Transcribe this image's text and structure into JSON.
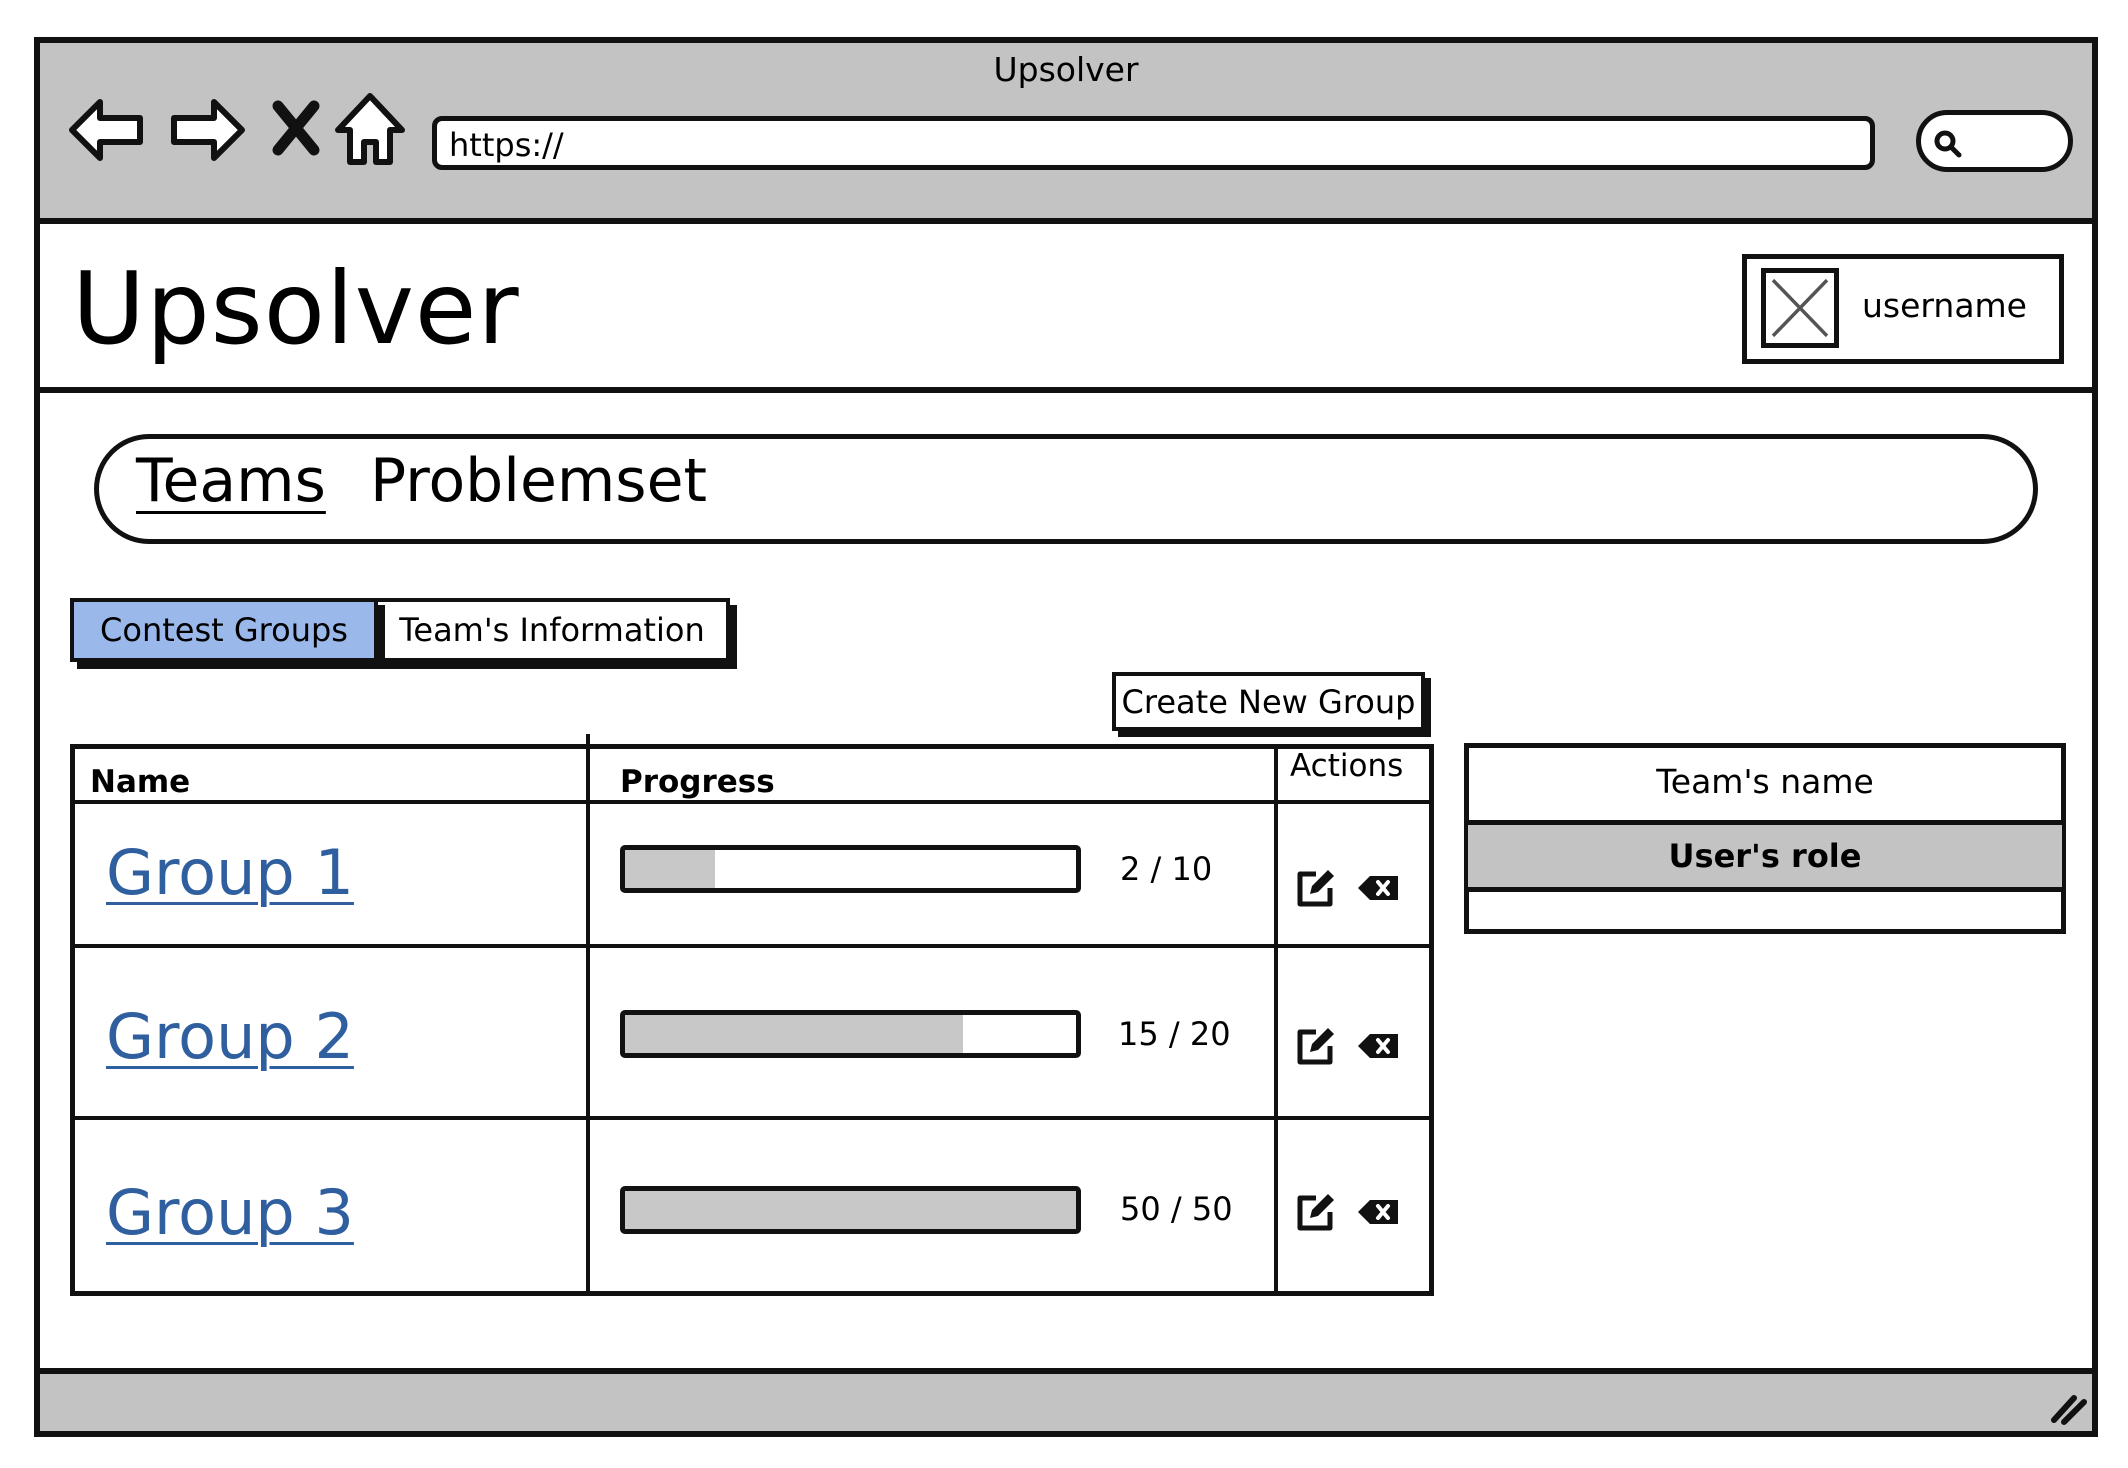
{
  "browser": {
    "title": "Upsolver",
    "url": "https://",
    "icons": [
      "back-arrow-icon",
      "forward-arrow-icon",
      "close-icon",
      "home-icon",
      "search-icon",
      "resize-grip-icon"
    ]
  },
  "app": {
    "title": "Upsolver",
    "username": "username"
  },
  "nav": {
    "items": [
      {
        "label": "Teams",
        "active": true
      },
      {
        "label": "Problemset",
        "active": false
      }
    ]
  },
  "tabs": [
    {
      "label": "Contest Groups",
      "selected": true
    },
    {
      "label": "Team's Information",
      "selected": false
    }
  ],
  "toolbar": {
    "create_label": "Create New Group"
  },
  "groups_table": {
    "columns": [
      "Name",
      "Progress",
      "Actions"
    ],
    "rows": [
      {
        "name": "Group 1",
        "progress": "2 / 10",
        "fraction": 0.2
      },
      {
        "name": "Group 2",
        "progress": "15 / 20",
        "fraction": 0.75
      },
      {
        "name": "Group 3",
        "progress": "50 / 50",
        "fraction": 1.0
      }
    ],
    "actions": [
      "edit-icon",
      "delete-icon"
    ]
  },
  "team_panel": {
    "header": "Team's name",
    "role": "User's role"
  },
  "colors": {
    "chrome_gray": "#c3c3c3",
    "selected_tab": "#9bb8ea",
    "link": "#2f5f9e",
    "progress_fill": "#c8c8c8"
  }
}
